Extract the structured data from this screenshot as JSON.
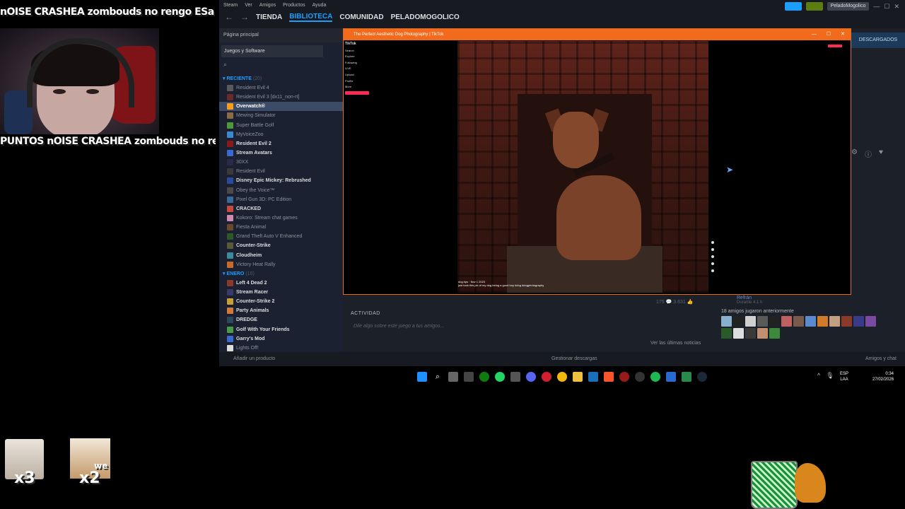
{
  "overlay": {
    "ticker_top": "nOISE CRASHEA zombouds no rengo ESa vozol",
    "ticker_mid": "PUNTOS nOISE CRASHEA zombouds no rengo",
    "multiplier_1": "x3",
    "multiplier_2": "x2",
    "we_label": "we"
  },
  "steam": {
    "menu": [
      "Steam",
      "Ver",
      "Amigos",
      "Productos",
      "Ayuda"
    ],
    "nav": {
      "store": "TIENDA",
      "library": "BIBLIOTECA",
      "community": "COMUNIDAD",
      "profile": "PELADOMOGOLICO"
    },
    "user": "PeladoMogolico",
    "sidebar": {
      "home": "Página principal",
      "filter": "Juegos y Software",
      "sections": [
        {
          "name": "RECIENTE",
          "count": "(20)",
          "games": [
            {
              "label": "Resident Evil 4",
              "bold": false,
              "color": "#5a5a5a"
            },
            {
              "label": "Resident Evil 3 [dx11_non-rt]",
              "bold": false,
              "color": "#6b2a2a"
            },
            {
              "label": "Overwatch®",
              "bold": true,
              "color": "#f99e1a",
              "selected": true
            },
            {
              "label": "Mewing Simulator",
              "bold": false,
              "color": "#8a6c4a"
            },
            {
              "label": "Super Battle Golf",
              "bold": false,
              "color": "#4a9a3a"
            },
            {
              "label": "MyVoiceZoo",
              "bold": false,
              "color": "#3a8ad0"
            },
            {
              "label": "Resident Evil 2",
              "bold": true,
              "color": "#8a1a1a"
            },
            {
              "label": "Stream Avatars",
              "bold": true,
              "color": "#3a6ad0"
            },
            {
              "label": "30XX",
              "bold": false,
              "color": "#2a2a4a"
            },
            {
              "label": "Resident Evil",
              "bold": false,
              "color": "#3a3a3a"
            },
            {
              "label": "Disney Epic Mickey: Rebrushed",
              "bold": true,
              "color": "#2a4a9a"
            },
            {
              "label": "Obey the Voice™",
              "bold": false,
              "color": "#4a4a4a"
            },
            {
              "label": "Pixel Gun 3D: PC Edition",
              "bold": false,
              "color": "#3a6a9a"
            },
            {
              "label": "CRACKED",
              "bold": true,
              "color": "#c84a3a"
            },
            {
              "label": "Kokoro: Stream chat games",
              "bold": false,
              "color": "#d08ab0"
            },
            {
              "label": "Fiesta Animal",
              "bold": false,
              "color": "#6a4a2a"
            },
            {
              "label": "Grand Theft Auto V Enhanced",
              "bold": false,
              "color": "#2a5a2a"
            },
            {
              "label": "Counter-Strike",
              "bold": true,
              "color": "#5a5a3a"
            },
            {
              "label": "Cloudheim",
              "bold": true,
              "color": "#3a8aa0"
            },
            {
              "label": "Victory Heat Rally",
              "bold": false,
              "color": "#c86a2a"
            }
          ]
        },
        {
          "name": "ENERO",
          "count": "(16)",
          "games": [
            {
              "label": "Left 4 Dead 2",
              "bold": true,
              "color": "#8a3a2a"
            },
            {
              "label": "Stream Racer",
              "bold": true,
              "color": "#3a3a6a"
            },
            {
              "label": "Counter-Strike 2",
              "bold": true,
              "color": "#c8a03a"
            },
            {
              "label": "Party Animals",
              "bold": true,
              "color": "#d07a3a"
            },
            {
              "label": "DREDGE",
              "bold": true,
              "color": "#2a4a5a"
            },
            {
              "label": "Golf With Your Friends",
              "bold": true,
              "color": "#4a9a4a"
            },
            {
              "label": "Garry's Mod",
              "bold": true,
              "color": "#3a6ad0"
            },
            {
              "label": "Lights Off!",
              "bold": false,
              "color": "#dddddd"
            }
          ]
        }
      ],
      "add_product": "Añadir un producto"
    },
    "main": {
      "downloads": "DESCARGADOS",
      "activity": "ACTIVIDAD",
      "activity_placeholder": "Dile algo sobre este juego a tus amigos...",
      "news_link": "Ver las últimas noticias",
      "counts": "175 💬   3.631 👍",
      "friend_name": "Refrán",
      "friend_time_1": "Durante 11 h",
      "friend_time_2": "Durante 4.1 h",
      "friend_time_3": "Durante 4.3 h",
      "friends_played": "18 amigos jugaron anteriormente"
    },
    "status": {
      "downloads": "Gestionar descargas",
      "friends_chat": "Amigos y chat"
    }
  },
  "tiktok": {
    "title": "The Perfect Aesthetic Dog Photography | TikTok",
    "brand": "TikTok",
    "menu": [
      "Search",
      "Explore",
      "Following",
      "LIVE",
      "Upload",
      "Profile",
      "More"
    ],
    "login": "Log in",
    "caption": "dog.tips · Nov 1 2023",
    "caption_2": "just took this pic of my dog being a good boy #dog #dogphotography",
    "right_login": "Log in"
  },
  "taskbar": {
    "lang_1": "ESP",
    "lang_2": "LAA",
    "time": "0:34",
    "date": "27/02/2026"
  }
}
